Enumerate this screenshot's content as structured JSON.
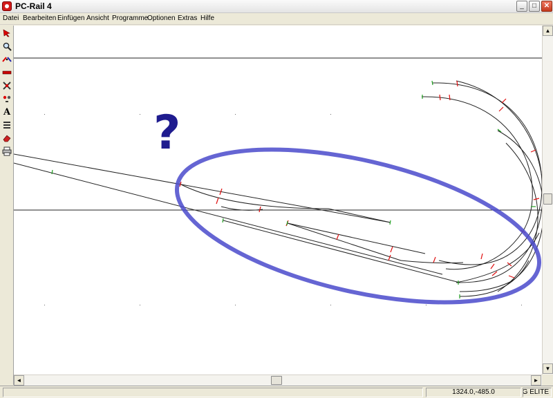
{
  "window": {
    "title": "PC-Rail 4"
  },
  "title_buttons": {
    "minimize": "_",
    "maximize": "□",
    "close": "✕"
  },
  "menu": [
    {
      "label": "Datei"
    },
    {
      "label": "Bearbeiten"
    },
    {
      "label": "Einfügen"
    },
    {
      "label": "Ansicht"
    },
    {
      "label": "Programme"
    },
    {
      "label": "Optionen"
    },
    {
      "label": "Extras"
    },
    {
      "label": "Hilfe"
    }
  ],
  "toolbar": {
    "tools": [
      {
        "icon": "select-arrow-icon"
      },
      {
        "icon": "zoom-magnifier-icon"
      },
      {
        "icon": "track-connect-icon"
      },
      {
        "icon": "straight-track-icon"
      },
      {
        "icon": "crossing-icon"
      },
      {
        "icon": "signal-icon"
      },
      {
        "icon": "text-tool-icon",
        "glyph": "A"
      },
      {
        "icon": "layers-icon"
      },
      {
        "icon": "eraser-icon"
      },
      {
        "icon": "printer-icon"
      }
    ]
  },
  "annotation": {
    "question_mark": "?"
  },
  "colors": {
    "ellipse": "#4a4acb",
    "question_mark": "#1f1c8f",
    "track": "#222222",
    "joint_red": "#e01010",
    "joint_green": "#20a020"
  },
  "scrollbars": {
    "up": "▲",
    "down": "▼",
    "left": "◄",
    "right": "►"
  },
  "status": {
    "coordinates": "1324.0,-485.0",
    "library": "ILLIG ELITE"
  }
}
